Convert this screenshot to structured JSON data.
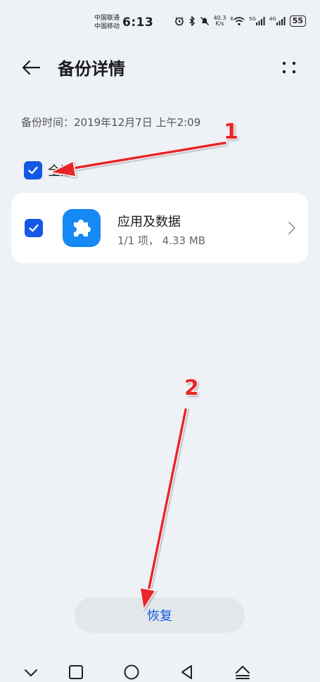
{
  "status_bar": {
    "carrier_1": "中国联通",
    "carrier_2": "中国移动",
    "time": "6:13",
    "net_speed": "40.3",
    "net_speed_unit": "K/s",
    "net_5g": "5G",
    "net_4g": "4G",
    "wifi_badge": "6",
    "battery": "55"
  },
  "header": {
    "title": "备份详情",
    "back_icon": "arrow-left-icon",
    "more_icon": "more-dots-icon"
  },
  "backup_time": "备份时间：2019年12月7日 上午2:09",
  "select_all": {
    "label": "全选",
    "checked": true
  },
  "items": [
    {
      "title": "应用及数据",
      "subtitle": "1/1 项， 4.33 MB",
      "icon": "puzzle-icon",
      "checked": true
    }
  ],
  "restore_button": "恢复",
  "annotations": [
    "1",
    "2"
  ],
  "colors": {
    "accent": "#1458e6",
    "app_icon": "#1689f5",
    "annotation": "#e8252a",
    "background": "#eef1f6"
  }
}
